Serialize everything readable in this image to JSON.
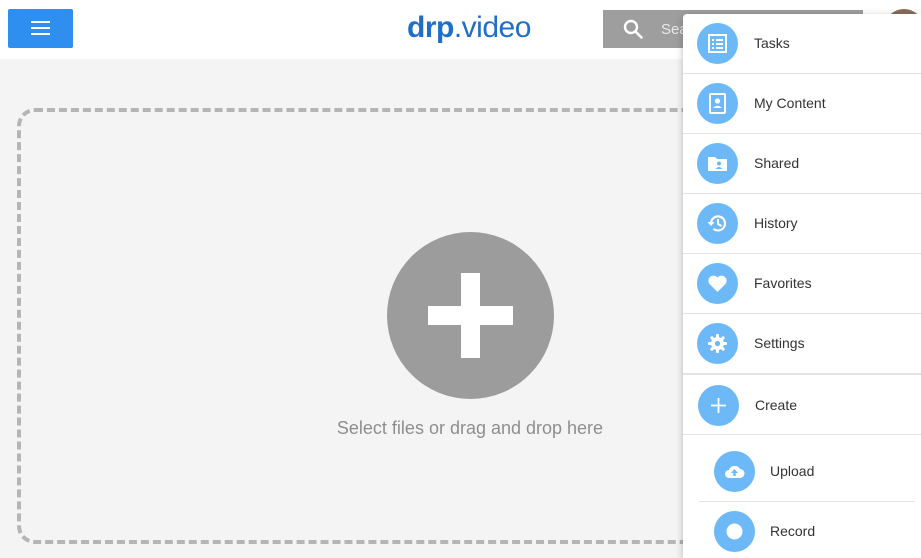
{
  "header": {
    "logo_part1": "dr",
    "logo_part2": "p",
    "logo_part3": ".video",
    "search_placeholder": "Search",
    "brand_color": "#1f6fc9",
    "menu_button_color": "#2f8ff0"
  },
  "dropzone": {
    "label": "Select files or drag and drop here"
  },
  "menu": {
    "items": [
      {
        "label": "Tasks",
        "icon": "tasks-icon"
      },
      {
        "label": "My Content",
        "icon": "content-icon"
      },
      {
        "label": "Shared",
        "icon": "shared-folder-icon"
      },
      {
        "label": "History",
        "icon": "history-icon"
      },
      {
        "label": "Favorites",
        "icon": "heart-icon"
      },
      {
        "label": "Settings",
        "icon": "gear-icon"
      },
      {
        "label": "Create",
        "icon": "plus-icon"
      }
    ],
    "sub_items": [
      {
        "label": "Upload",
        "icon": "cloud-upload-icon"
      },
      {
        "label": "Record",
        "icon": "record-icon"
      }
    ],
    "icon_color": "#6db8f6"
  }
}
